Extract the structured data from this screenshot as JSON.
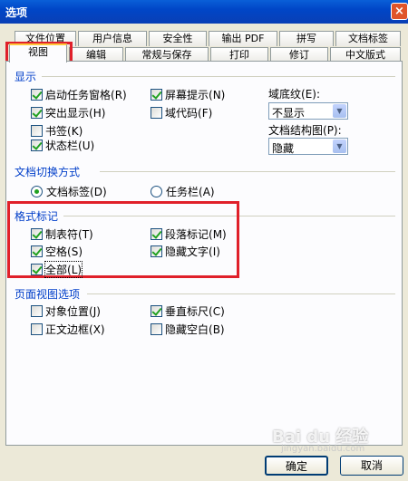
{
  "window": {
    "title": "选项",
    "close_label": "×"
  },
  "tabs_row1": [
    "文件位置",
    "用户信息",
    "安全性",
    "输出 PDF",
    "拼写",
    "文档标签"
  ],
  "tabs_row2": [
    "视图",
    "编辑",
    "常规与保存",
    "打印",
    "修订",
    "中文版式"
  ],
  "active_tab": "视图",
  "display": {
    "title": "显示",
    "startup_task_pane": {
      "label": "启动任务窗格",
      "key": "(R)",
      "checked": true
    },
    "highlight": {
      "label": "突出显示",
      "key": "(H)",
      "checked": true
    },
    "bookmark": {
      "label": "书签",
      "key": "(K)",
      "checked": false
    },
    "status_bar": {
      "label": "状态栏",
      "key": "(U)",
      "checked": true
    },
    "screen_tips": {
      "label": "屏幕提示",
      "key": "(N)",
      "checked": true
    },
    "field_codes": {
      "label": "域代码",
      "key": "(F)",
      "checked": false
    },
    "field_shading": {
      "label": "域底纹",
      "key": "(E):",
      "value": "不显示"
    },
    "doc_map": {
      "label": "文档结构图",
      "key": "(P):",
      "value": "隐藏"
    }
  },
  "switch_mode": {
    "title": "文档切换方式",
    "doc_tabs": {
      "label": "文档标签",
      "key": "(D)",
      "checked": true
    },
    "taskbar": {
      "label": "任务栏",
      "key": "(A)",
      "checked": false
    }
  },
  "format_marks": {
    "title": "格式标记",
    "tab_chars": {
      "label": "制表符",
      "key": "(T)",
      "checked": true
    },
    "spaces": {
      "label": "空格",
      "key": "(S)",
      "checked": true
    },
    "all": {
      "label": "全部",
      "key": "(L)",
      "checked": true
    },
    "paragraph_marks": {
      "label": "段落标记",
      "key": "(M)",
      "checked": true
    },
    "hidden_text": {
      "label": "隐藏文字",
      "key": "(I)",
      "checked": true
    }
  },
  "page_view": {
    "title": "页面视图选项",
    "object_anchors": {
      "label": "对象位置",
      "key": "(J)",
      "checked": false
    },
    "text_boundaries": {
      "label": "正文边框",
      "key": "(X)",
      "checked": false
    },
    "vertical_ruler": {
      "label": "垂直标尺",
      "key": "(C)",
      "checked": true
    },
    "hide_whitespace": {
      "label": "隐藏空白",
      "key": "(B)",
      "checked": false
    }
  },
  "buttons": {
    "ok": "确定",
    "cancel": "取消"
  },
  "watermark": {
    "logo": "Bai du 经验",
    "url": "jingyan.baidu.com"
  },
  "colors": {
    "titlebar": "#0046c7",
    "group_title": "#003ec9",
    "highlight_box": "#e0202a",
    "dialog_bg": "#ece9d8"
  }
}
